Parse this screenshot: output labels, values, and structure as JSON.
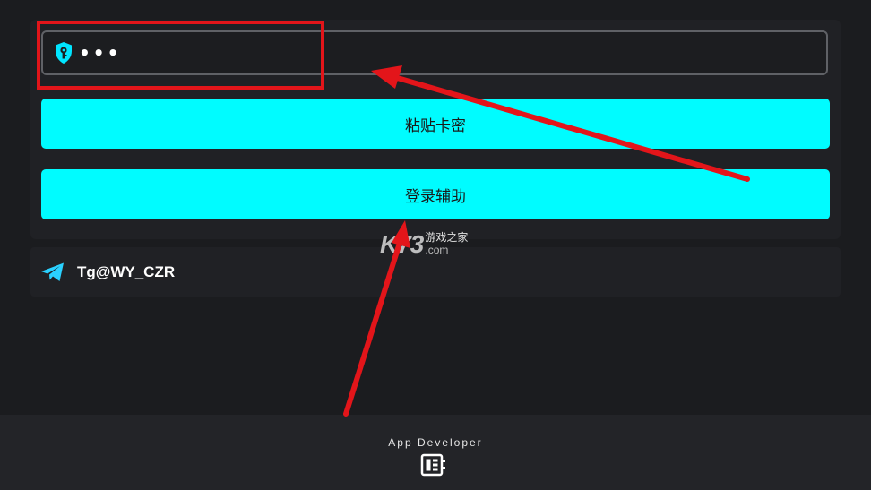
{
  "key_input": {
    "value": "•••",
    "icon": "shield-key-icon"
  },
  "buttons": {
    "paste_label": "粘贴卡密",
    "login_label": "登录辅助"
  },
  "contact": {
    "icon": "telegram-icon",
    "handle": "Tg@WY_CZR"
  },
  "footer": {
    "label": "App Developer",
    "icon": "developer-icon"
  },
  "watermark": {
    "logo": "K73",
    "name": "游戏之家",
    "domain": ".com"
  },
  "colors": {
    "background": "#1b1c1f",
    "accent": "#00fcff",
    "annotation": "#e3151a"
  }
}
